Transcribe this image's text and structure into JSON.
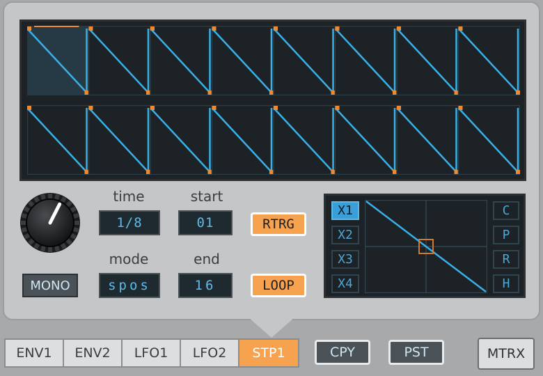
{
  "colors": {
    "accent_orange": "#f6a24e",
    "wave_blue": "#3ab0e8",
    "node_orange": "#f08a30",
    "display_bg": "#1c2226"
  },
  "step_lanes": {
    "steps": 8,
    "lane1": {
      "values": [
        1,
        1,
        1,
        1,
        1,
        1,
        1,
        1
      ],
      "playhead_step": 0
    },
    "lane2": {
      "values": [
        1,
        1,
        1,
        1,
        1,
        1,
        1,
        1
      ]
    }
  },
  "knob": {
    "value": 0.6
  },
  "controls": {
    "time_label": "time",
    "time_value": "1/8",
    "start_label": "start",
    "start_value": "01",
    "mode_label": "mode",
    "mode_value": "spos",
    "end_label": "end",
    "end_value": "16",
    "mono": "MONO",
    "retrigger": "RTRG",
    "loop": "LOOP"
  },
  "matrix": {
    "left_buttons": [
      "X1",
      "X2",
      "X3",
      "X4"
    ],
    "selected_left": 0,
    "right_buttons": [
      "C",
      "P",
      "R",
      "H"
    ],
    "curve_icon": "diagonal-ramp-down"
  },
  "tabs": [
    "ENV1",
    "ENV2",
    "LFO1",
    "LFO2",
    "STP1"
  ],
  "active_tab": 4,
  "bottom": {
    "copy": "CPY",
    "paste": "PST",
    "matrix": "MTRX"
  }
}
